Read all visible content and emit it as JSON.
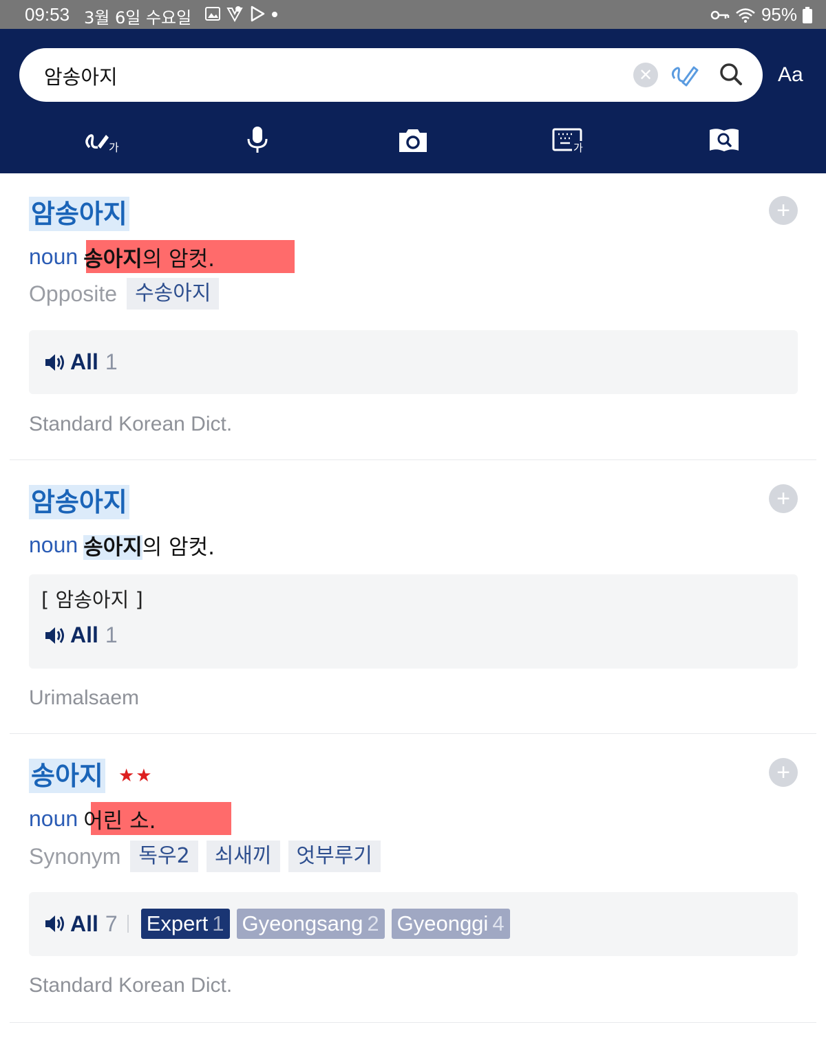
{
  "status_bar": {
    "time": "09:53",
    "date": "3월 6일 수요일",
    "battery": "95%"
  },
  "search": {
    "query": "암송아지",
    "aa_label": "Aa"
  },
  "entries": [
    {
      "headword": "암송아지",
      "pos": "noun",
      "definition_highlight": "송아지",
      "definition_rest": "의 암컷.",
      "relation_label": "Opposite",
      "relations": [
        "수송아지"
      ],
      "audio": {
        "all_label": "All",
        "all_count": "1"
      },
      "source": "Standard Korean Dict."
    },
    {
      "headword": "암송아지",
      "pos": "noun",
      "definition_highlight": "송아지",
      "definition_rest": "의 암컷.",
      "pronunciation": "[ 암송아지 ]",
      "audio": {
        "all_label": "All",
        "all_count": "1"
      },
      "source": "Urimalsaem"
    },
    {
      "headword": "송아지",
      "stars": "★★",
      "pos": "noun",
      "definition": "어린 소.",
      "relation_label": "Synonym",
      "relations": [
        "독우2",
        "쇠새끼",
        "엇부루기"
      ],
      "audio": {
        "all_label": "All",
        "all_count": "7",
        "tags": [
          {
            "label": "Expert",
            "count": "1"
          },
          {
            "label": "Gyeongsang",
            "count": "2"
          },
          {
            "label": "Gyeonggi",
            "count": "4"
          }
        ]
      },
      "source": "Standard Korean Dict."
    }
  ],
  "colors": {
    "header_bg": "#0c2158",
    "headword_text": "#1a64b8",
    "headword_bg": "#dcebfa",
    "red_highlight": "#ff6b6b",
    "stars": "#dd1f1f"
  }
}
